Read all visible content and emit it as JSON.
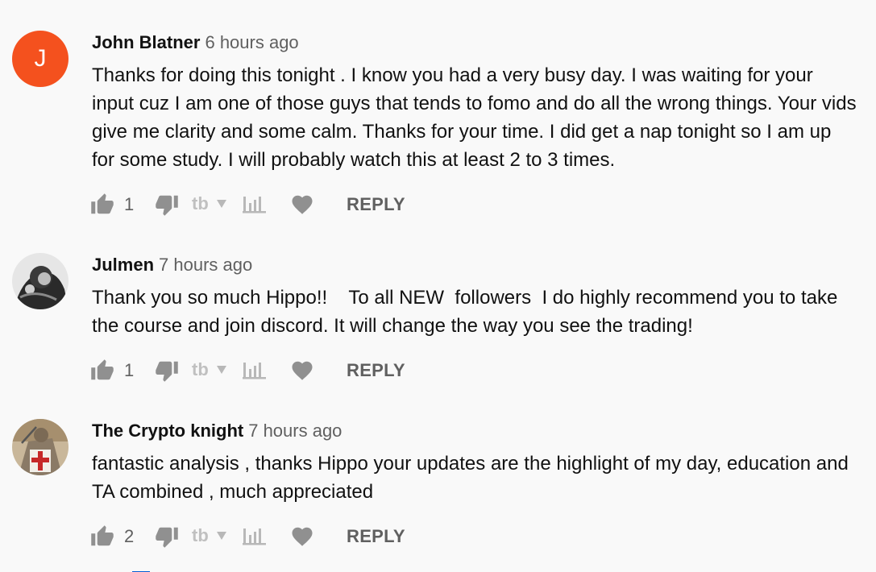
{
  "comments": [
    {
      "author": "John Blatner",
      "time": "6 hours ago",
      "avatar_letter": "J",
      "text": "Thanks for doing this tonight . I know you had a very busy day. I was waiting for your input cuz I am one of those guys that tends to fomo and do all the wrong things. Your vids give me clarity and some calm. Thanks for your time. I did get a nap tonight so I am up for some study. I will probably watch this at least 2 to 3 times.",
      "likes": "1",
      "reply_label": "REPLY"
    },
    {
      "author": "Julmen",
      "time": "7 hours ago",
      "text": "Thank you so much Hippo!!    To all NEW  followers  I do highly recommend you to take the course and join discord. It will change the way you see the trading!",
      "likes": "1",
      "reply_label": "REPLY"
    },
    {
      "author": "The Crypto knight",
      "time": "7 hours ago",
      "text": "fantastic analysis , thanks Hippo your updates are the highlight of my day, education and TA combined , much appreciated",
      "likes": "2",
      "reply_label": "REPLY"
    }
  ],
  "colors": {
    "avatar_orange": "#f4511e",
    "icon_gray": "#909090",
    "link_blue": "#065fd4"
  },
  "icons": [
    "thumbs-up-icon",
    "thumbs-down-icon",
    "tb-extension-icon",
    "bar-chart-icon",
    "heart-icon"
  ]
}
